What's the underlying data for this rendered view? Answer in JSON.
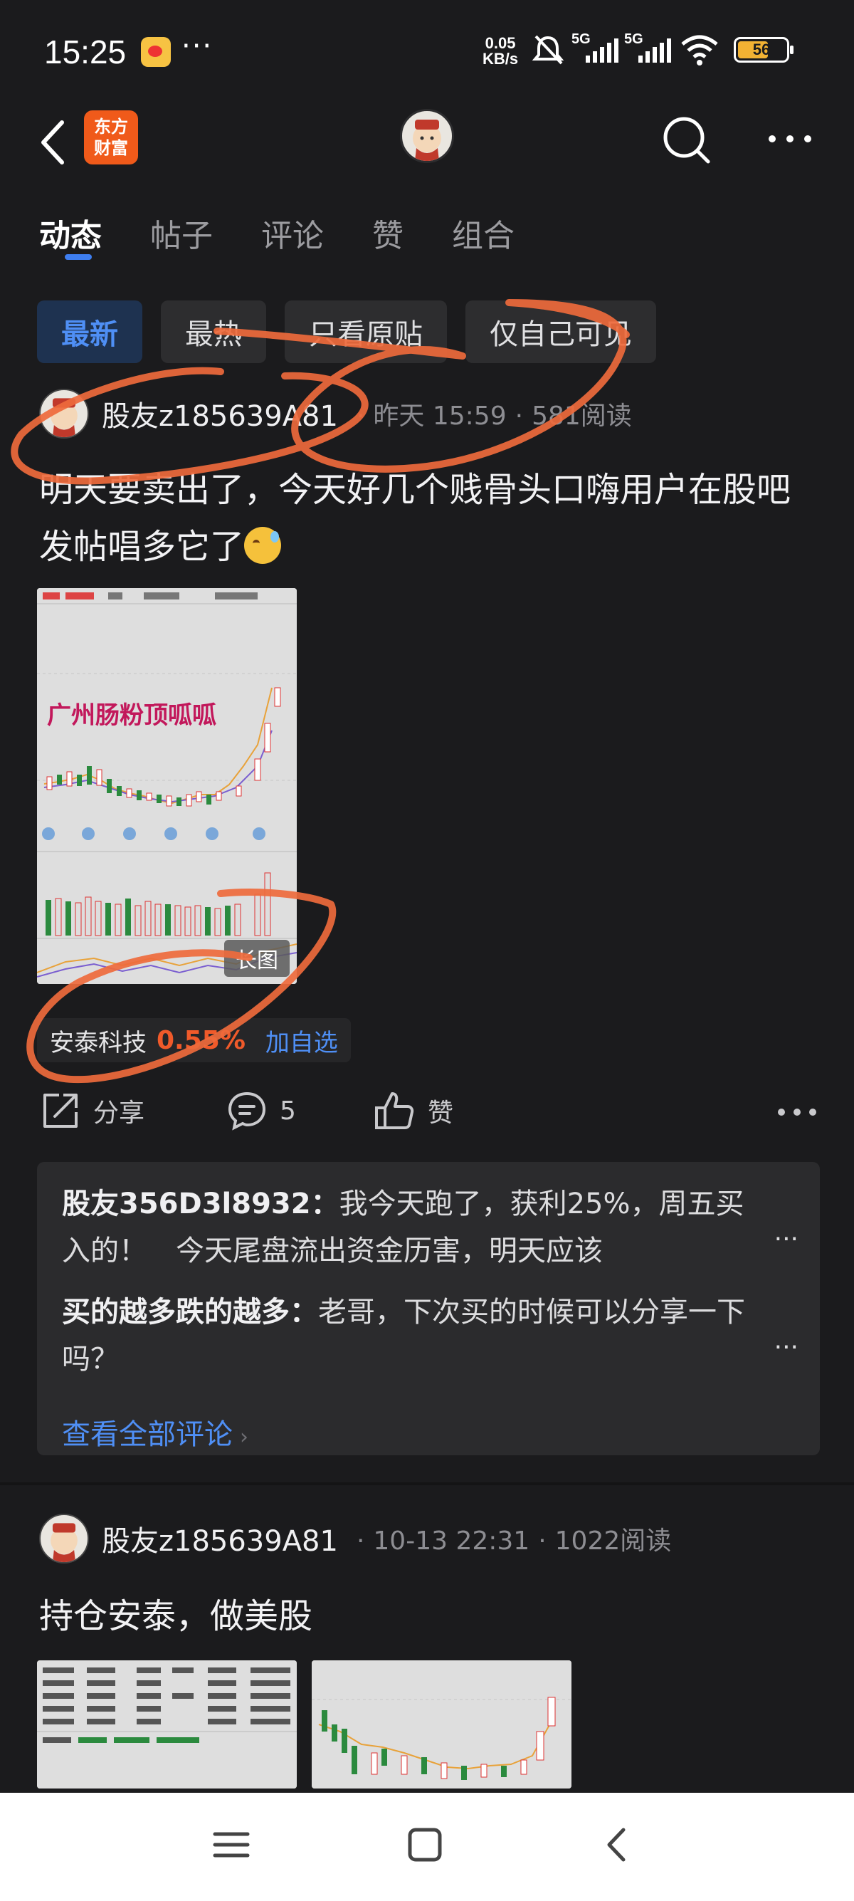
{
  "status": {
    "time": "15:25",
    "speed_value": "0.05",
    "speed_unit": "KB/s",
    "network1": "5G",
    "network2": "5G",
    "battery": "56"
  },
  "nav": {
    "logo_line1": "东方",
    "logo_line2": "财富"
  },
  "tabs": [
    "动态",
    "帖子",
    "评论",
    "赞",
    "组合"
  ],
  "filters": [
    "最新",
    "最热",
    "只看原贴",
    "仅自己可见"
  ],
  "post1": {
    "author": "股友z185639A81",
    "time": "昨天 15:59",
    "reads": "581阅读",
    "text": "明天要卖出了，今天好几个贱骨头口嗨用户在股吧发帖唱多它了",
    "image_overlay_text": "广州肠粉顶呱呱",
    "image_badge": "长图",
    "stock": {
      "name": "安泰科技",
      "change": "0.55%",
      "add_label": "加自选"
    },
    "actions": {
      "share": "分享",
      "comment_count": "5",
      "like": "赞"
    },
    "comments": [
      {
        "user": "股友356D3l8932：",
        "text": "我今天跑了，获利25%，周五买入的！　今天尾盘流出资金历害，明天应该"
      },
      {
        "user": "买的越多跌的越多：",
        "text": "老哥，下次买的时候可以分享一下吗？"
      }
    ],
    "view_all": "查看全部评论"
  },
  "post2": {
    "author": "股友z185639A81",
    "time": "10-13 22:31",
    "reads": "1022阅读",
    "text": "持仓安泰，做美股"
  },
  "colors": {
    "background": "#1b1b1d",
    "accent_blue": "#4f8ff5",
    "up_red": "#f05a2a",
    "brand_orange": "#f05a1a",
    "annotation": "#ee6a3c"
  }
}
